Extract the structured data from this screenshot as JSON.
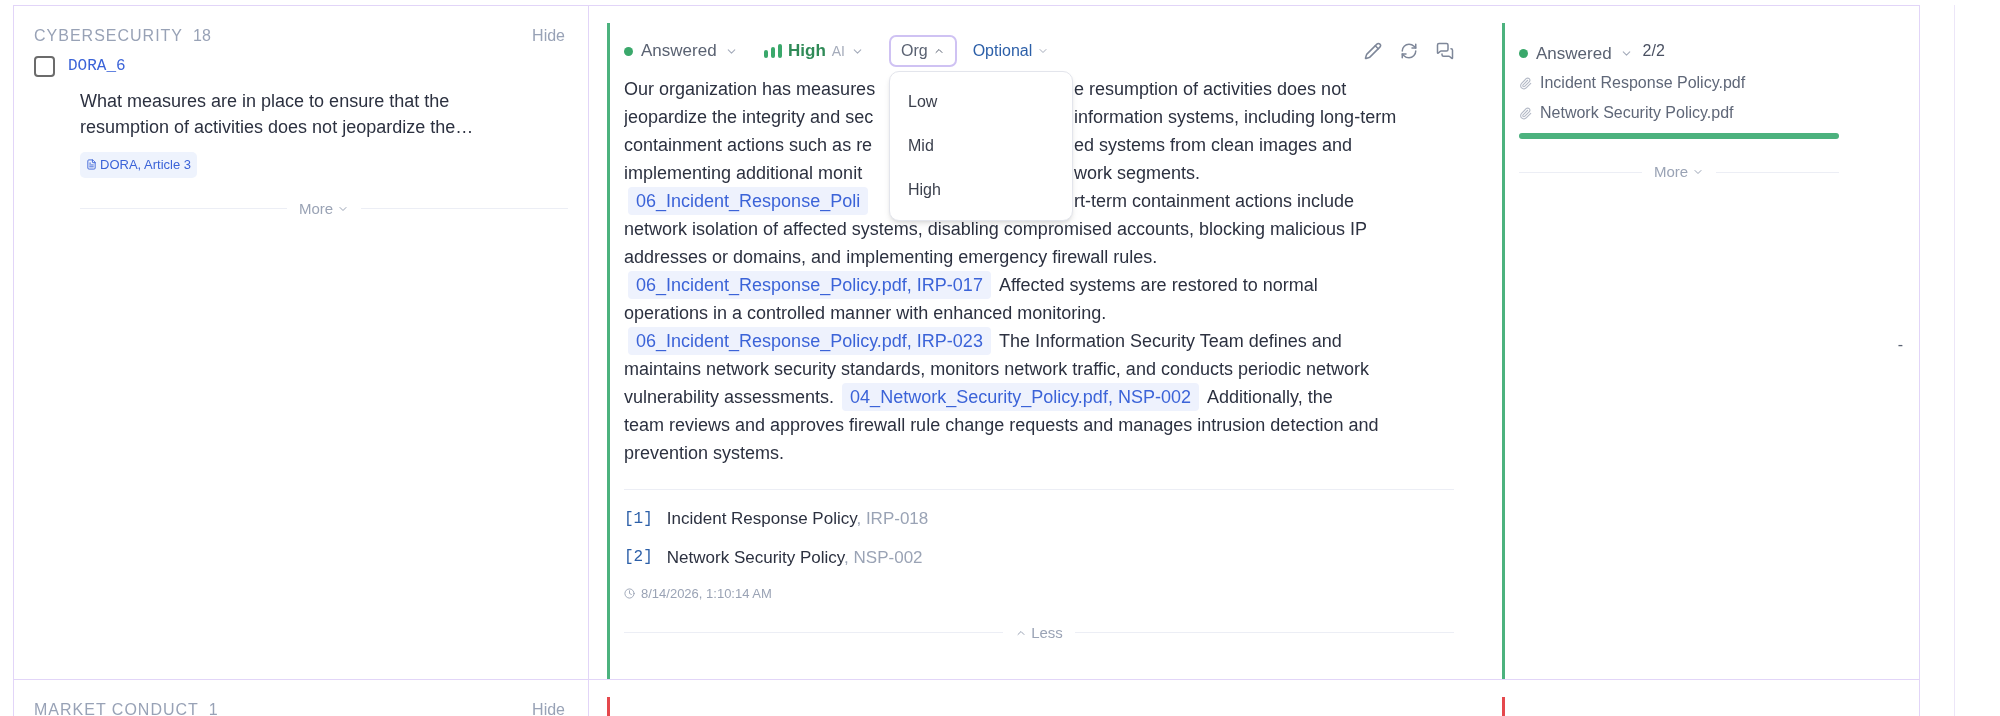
{
  "sections": [
    {
      "category": "CYBERSECURITY",
      "count": "18",
      "hide": "Hide",
      "color": "#4cb27e",
      "question": {
        "id": "DORA_6",
        "checked": false,
        "text": "What measures are in place to ensure that the resumption of activities does not jeopardize the…",
        "tags": [
          "DORA, Article 3"
        ],
        "more": "More"
      },
      "answer": {
        "status": "Answered",
        "confidence": "High",
        "confidence_source": "AI",
        "org": {
          "label": "Org",
          "expanded": true,
          "options": [
            "Low",
            "Mid",
            "High"
          ]
        },
        "requirement": "Optional",
        "lines": [
          {
            "left": [
              {
                "kind": "text",
                "text": "Our organization has measures"
              }
            ],
            "right": [
              {
                "kind": "text",
                "text": "e resumption of activities does not"
              }
            ]
          },
          {
            "left": [
              {
                "kind": "text",
                "text": "jeopardize the integrity and sec"
              }
            ],
            "right": [
              {
                "kind": "text",
                "text": "information systems, including long-term"
              }
            ]
          },
          {
            "left": [
              {
                "kind": "text",
                "text": "containment actions such as re"
              }
            ],
            "right": [
              {
                "kind": "text",
                "text": "ed systems from clean images and"
              }
            ]
          },
          {
            "left": [
              {
                "kind": "text",
                "text": "implementing additional monit"
              }
            ],
            "right": [
              {
                "kind": "text",
                "text": "work segments."
              }
            ]
          },
          {
            "left": [
              {
                "kind": "citation",
                "text": "06_Incident_Response_Poli"
              }
            ],
            "right": [
              {
                "kind": "text",
                "text": "rt-term containment actions include"
              }
            ]
          },
          {
            "left": [
              {
                "kind": "text",
                "text": "network isolation of affected systems, disabling compromised accounts, blocking malicious IP"
              }
            ]
          },
          {
            "left": [
              {
                "kind": "text",
                "text": "addresses or domains, and implementing emergency firewall rules."
              }
            ]
          },
          {
            "left": [
              {
                "kind": "citation",
                "text": "06_Incident_Response_Policy.pdf, IRP-017"
              },
              {
                "kind": "text",
                "text": "Affected systems are restored to normal"
              }
            ]
          },
          {
            "left": [
              {
                "kind": "text",
                "text": "operations in a controlled manner with enhanced monitoring."
              }
            ]
          },
          {
            "left": [
              {
                "kind": "citation",
                "text": "06_Incident_Response_Policy.pdf, IRP-023"
              },
              {
                "kind": "text",
                "text": "The Information Security Team defines and"
              }
            ]
          },
          {
            "left": [
              {
                "kind": "text",
                "text": "maintains network security standards, monitors network traffic, and conducts periodic network"
              }
            ]
          },
          {
            "left": [
              {
                "kind": "text",
                "text": "vulnerability assessments."
              },
              {
                "kind": "citation",
                "text": "04_Network_Security_Policy.pdf, NSP-002"
              },
              {
                "kind": "text",
                "text": "Additionally, the"
              }
            ]
          },
          {
            "left": [
              {
                "kind": "text",
                "text": "team reviews and approves firewall rule change requests and manages intrusion detection and"
              }
            ]
          },
          {
            "left": [
              {
                "kind": "text",
                "text": "prevention systems."
              }
            ]
          }
        ],
        "references": [
          {
            "index": "[1]",
            "title": "Incident Response Policy",
            "code": ", IRP-018"
          },
          {
            "index": "[2]",
            "title": "Network Security Policy",
            "code": ", NSP-002"
          }
        ],
        "timestamp": "8/14/2026, 1:10:14 AM",
        "less": "Less"
      },
      "review": {
        "status": "Answered",
        "count": "2/2",
        "files": [
          "Incident Response Policy.pdf",
          "Network Security Policy.pdf"
        ],
        "level": 1,
        "more": "More"
      },
      "extra": "-"
    },
    {
      "category": "MARKET CONDUCT",
      "count": "1",
      "hide": "Hide",
      "color": "#e5484d"
    }
  ]
}
